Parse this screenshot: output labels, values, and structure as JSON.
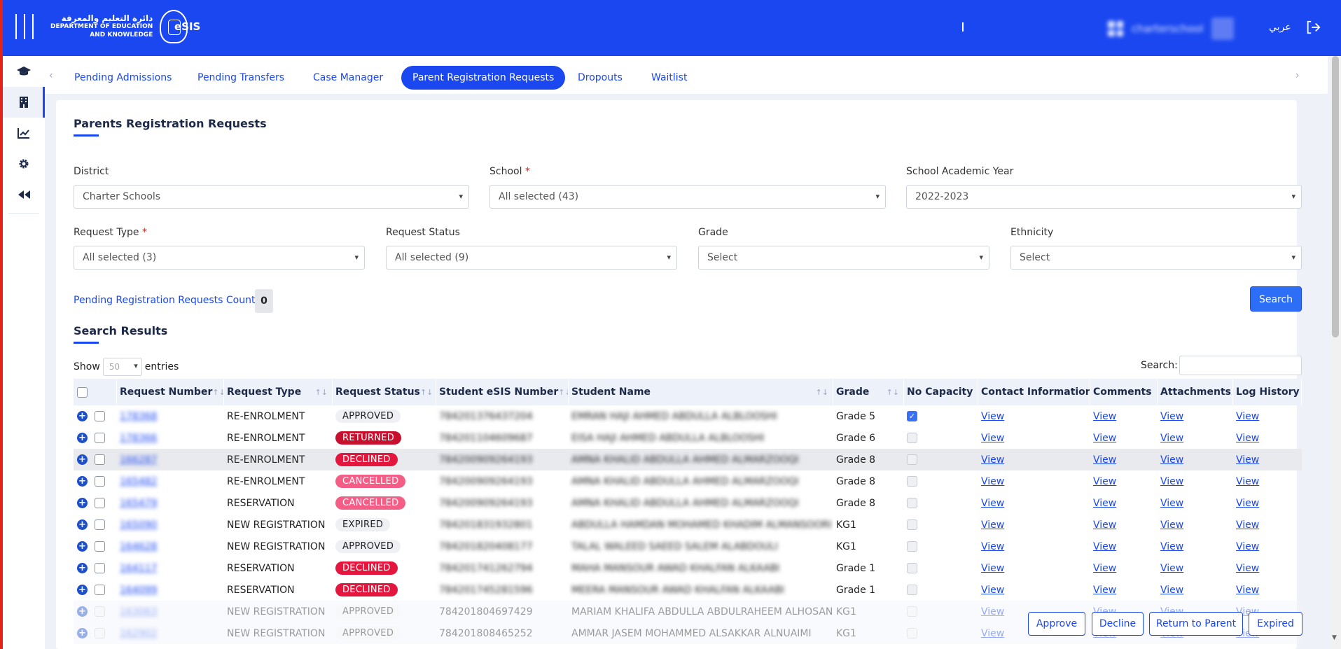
{
  "header": {
    "org_ar": "دائرة التعليم والمعرفة",
    "org_en_1": "DEPARTMENT OF EDUCATION",
    "org_en_2": "AND KNOWLEDGE",
    "app": "eSIS",
    "user": "charterschool",
    "lang": "عربي"
  },
  "sidebar": {
    "items": [
      {
        "icon": "graduation-cap-icon"
      },
      {
        "icon": "building-icon",
        "active": true
      },
      {
        "icon": "chart-line-icon"
      },
      {
        "icon": "gear-icon"
      },
      {
        "icon": "fast-backward-icon"
      }
    ]
  },
  "tabs": [
    {
      "label": "Pending Admissions"
    },
    {
      "label": "Pending Transfers"
    },
    {
      "label": "Case Manager"
    },
    {
      "label": "Parent Registration Requests",
      "active": true
    },
    {
      "label": "Dropouts"
    },
    {
      "label": "Waitlist"
    }
  ],
  "page": {
    "title": "Parents Registration Requests",
    "filters": {
      "district_label": "District",
      "district_value": "Charter Schools",
      "school_label": "School",
      "school_value": "All selected (43)",
      "year_label": "School Academic Year",
      "year_value": "2022-2023",
      "request_type_label": "Request Type",
      "request_type_value": "All selected (3)",
      "request_status_label": "Request Status",
      "request_status_value": "All selected (9)",
      "grade_label": "Grade",
      "grade_value": "Select",
      "ethnicity_label": "Ethnicity",
      "ethnicity_value": "Select",
      "required_mark": "*"
    },
    "count_label": "Pending Registration Requests Count",
    "count_value": "0",
    "search_button": "Search",
    "results_title": "Search Results",
    "show_label": "Show",
    "show_value": "50",
    "entries_label": "entries",
    "search_label": "Search:"
  },
  "table": {
    "columns": [
      "Request Number",
      "Request Type",
      "Request Status",
      "Student eSIS Number",
      "Student Name",
      "Grade",
      "No Capacity",
      "Contact Information",
      "Comments",
      "Attachments",
      "Log History"
    ],
    "link_text": "View",
    "rows": [
      {
        "num": "178368",
        "type": "RE-ENROLMENT",
        "status": "APPROVED",
        "sc": "approved",
        "esis": "784201376437204",
        "name": "EMRAN HAJI AHMED ABDULLA ALBLOOSHI",
        "grade": "Grade 5",
        "cap": true
      },
      {
        "num": "178366",
        "type": "RE-ENROLMENT",
        "status": "RETURNED",
        "sc": "returned",
        "esis": "784201104609687",
        "name": "EISA HAJI AHMED ABDULLA ALBLOOSHI",
        "grade": "Grade 6",
        "cap": false
      },
      {
        "num": "166287",
        "type": "RE-ENROLMENT",
        "status": "DECLINED",
        "sc": "declined",
        "esis": "784200909264193",
        "name": "AMNA KHALID ABDULLA AHMED ALMARZOOQI",
        "grade": "Grade 8",
        "cap": false
      },
      {
        "num": "165482",
        "type": "RE-ENROLMENT",
        "status": "CANCELLED",
        "sc": "cancelled",
        "esis": "784200909264193",
        "name": "AMNA KHALID ABDULLA AHMED ALMARZOOQI",
        "grade": "Grade 8",
        "cap": false
      },
      {
        "num": "165479",
        "type": "RESERVATION",
        "status": "CANCELLED",
        "sc": "cancelled",
        "esis": "784200909264193",
        "name": "AMNA KHALID ABDULLA AHMED ALMARZOOQI",
        "grade": "Grade 8",
        "cap": false
      },
      {
        "num": "165090",
        "type": "NEW REGISTRATION",
        "status": "EXPIRED",
        "sc": "expired",
        "esis": "784201831932801",
        "name": "ABDULLA HAMDAN MOHAMED KHADIM ALMANSOORI",
        "grade": "KG1",
        "cap": false
      },
      {
        "num": "164628",
        "type": "NEW REGISTRATION",
        "status": "APPROVED",
        "sc": "approved",
        "esis": "784201820408177",
        "name": "TALAL WALEED SAEED SALEM ALABDOULI",
        "grade": "KG1",
        "cap": false
      },
      {
        "num": "164117",
        "type": "RESERVATION",
        "status": "DECLINED",
        "sc": "declined",
        "esis": "784201741262794",
        "name": "MAHA MANSOUR AWAD KHALFAN ALKAABI",
        "grade": "Grade 1",
        "cap": false
      },
      {
        "num": "164099",
        "type": "RESERVATION",
        "status": "DECLINED",
        "sc": "declined",
        "esis": "784201745281596",
        "name": "MEERA MANSOUR AWAD KHALFAN ALKAABI",
        "grade": "Grade 1",
        "cap": false
      },
      {
        "num": "163063",
        "type": "NEW REGISTRATION",
        "status": "APPROVED",
        "sc": "approved",
        "esis": "784201804697429",
        "name": "MARIAM KHALIFA ABDULLA ABDULRAHEEM ALHOSANI",
        "grade": "KG1",
        "cap": false
      },
      {
        "num": "162902",
        "type": "NEW REGISTRATION",
        "status": "APPROVED",
        "sc": "approved",
        "esis": "784201808465252",
        "name": "AMMAR JASEM MOHAMMED ALSAKKAR ALNUAIMI",
        "grade": "KG1",
        "cap": false
      }
    ]
  },
  "actions": {
    "approve": "Approve",
    "decline": "Decline",
    "return": "Return to Parent",
    "expired": "Expired"
  },
  "colors": {
    "primary": "#1a47f0",
    "returned": "#c8102e",
    "declined": "#e4163e",
    "cancelled": "#f45d86"
  }
}
